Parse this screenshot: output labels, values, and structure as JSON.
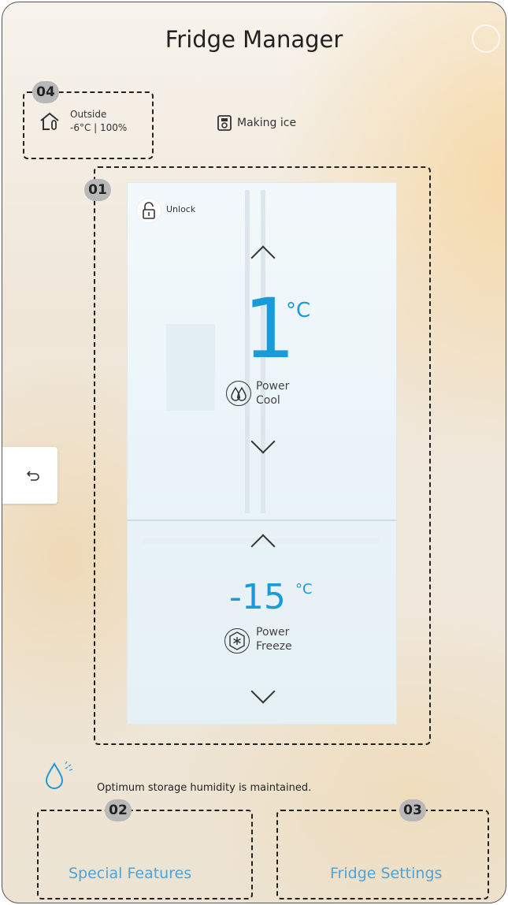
{
  "header": {
    "title": "Fridge Manager"
  },
  "outside": {
    "label": "Outside",
    "value": "-6°C | 100%"
  },
  "ice": {
    "label": "Making ice"
  },
  "fridge": {
    "lock_label": "Unlock",
    "fridge_temp": "1",
    "fridge_unit": "°C",
    "fridge_mode_line1": "Power",
    "fridge_mode_line2": "Cool",
    "freezer_temp": "-15",
    "freezer_unit": "°C",
    "freezer_mode_line1": "Power",
    "freezer_mode_line2": "Freeze"
  },
  "humidity": {
    "message": "Optimum storage humidity is maintained."
  },
  "callouts": {
    "fridge_area": "01",
    "special": "02",
    "settings": "03",
    "outside_area": "04"
  },
  "footer": {
    "special_features": "Special Features",
    "fridge_settings": "Fridge Settings"
  },
  "colors": {
    "accent": "#1a9bd9",
    "link": "#4fa3d8"
  }
}
